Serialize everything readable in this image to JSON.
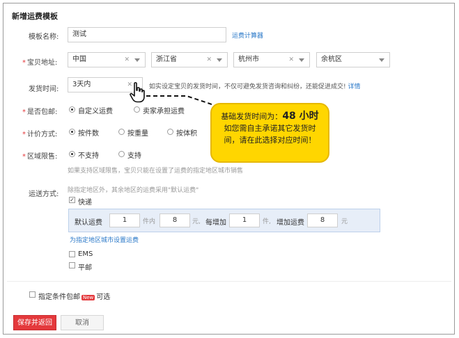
{
  "page_title": "新增运费模板",
  "fields": {
    "template_name": {
      "label": "模板名称:",
      "value": "测试",
      "link": "运费计算器"
    },
    "location": {
      "label": "宝贝地址:",
      "country": "中国",
      "province": "浙江省",
      "city": "杭州市",
      "district": "余杭区"
    },
    "ship_time": {
      "label": "发货时间:",
      "value": "3天内",
      "hint": "如实设定宝贝的发货时间，不仅可避免发货咨询和纠纷，还能促进成交!",
      "hint_link": "详情"
    },
    "free_shipping": {
      "label": "是否包邮:",
      "option_custom": "自定义运费",
      "option_seller": "卖家承担运费"
    },
    "pricing": {
      "label": "计价方式:",
      "by_count": "按件数",
      "by_weight": "按重量",
      "by_volume": "按体积"
    },
    "region_limit": {
      "label": "区域限售:",
      "option_no": "不支持",
      "option_yes": "支持",
      "hint": "如果支持区域限售，宝贝只能在设置了运费的指定地区城市销售"
    },
    "shipping_method": {
      "label": "运送方式:",
      "hint": "除指定地区外，其余地区的运费采用\"默认运费\"",
      "express": "快递",
      "default_fee_label": "默认运费",
      "first_count": "1",
      "unit_items": "件内",
      "first_fee": "8",
      "unit_yuan": "元,",
      "each_add_label": "每增加",
      "add_count": "1",
      "unit_item": "件,",
      "add_fee_label": "增加运费",
      "add_fee": "8",
      "unit_yuan2": "元",
      "set_region_link": "为指定地区城市设置运费",
      "ems": "EMS",
      "surface_mail": "平邮"
    },
    "conditional_free": {
      "label": "指定条件包邮",
      "badge": "New",
      "suffix": "可选"
    }
  },
  "callout": {
    "line1_prefix": "基础发货时间为：",
    "line1_value": "48 小时",
    "line2": "如您需自主承诺其它发货时",
    "line3": "间，请在此选择对应时间！"
  },
  "buttons": {
    "save": "保存并返回",
    "cancel": "取消"
  },
  "colors": {
    "accent": "#e4393c",
    "link": "#2a78c8",
    "callout": "#ffd600"
  }
}
